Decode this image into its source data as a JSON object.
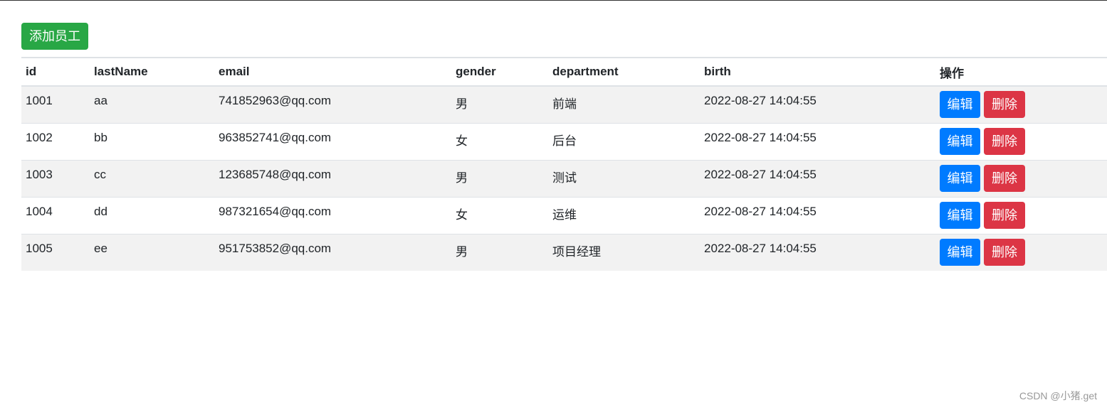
{
  "toolbar": {
    "add_label": "添加员工"
  },
  "table": {
    "headers": [
      "id",
      "lastName",
      "email",
      "gender",
      "department",
      "birth",
      "操作"
    ],
    "rows": [
      {
        "id": "1001",
        "lastName": "aa",
        "email": "741852963@qq.com",
        "gender": "男",
        "department": "前端",
        "birth": "2022-08-27 14:04:55"
      },
      {
        "id": "1002",
        "lastName": "bb",
        "email": "963852741@qq.com",
        "gender": "女",
        "department": "后台",
        "birth": "2022-08-27 14:04:55"
      },
      {
        "id": "1003",
        "lastName": "cc",
        "email": "123685748@qq.com",
        "gender": "男",
        "department": "测试",
        "birth": "2022-08-27 14:04:55"
      },
      {
        "id": "1004",
        "lastName": "dd",
        "email": "987321654@qq.com",
        "gender": "女",
        "department": "运维",
        "birth": "2022-08-27 14:04:55"
      },
      {
        "id": "1005",
        "lastName": "ee",
        "email": "951753852@qq.com",
        "gender": "男",
        "department": "项目经理",
        "birth": "2022-08-27 14:04:55"
      }
    ],
    "edit_label": "编辑",
    "delete_label": "删除"
  },
  "watermark": "CSDN @小猪.get",
  "colors": {
    "add": "#28a745",
    "edit": "#007bff",
    "delete": "#dc3545",
    "stripe": "#f2f2f2"
  }
}
